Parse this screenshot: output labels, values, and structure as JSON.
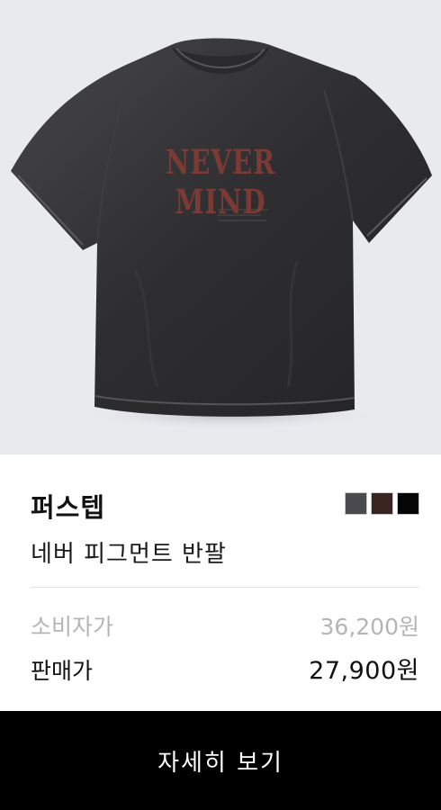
{
  "product": {
    "image_alt": "네버 피그먼트 반팔",
    "print_text": "NEVER MIND",
    "brand": "퍼스텝",
    "name": "네버 피그먼트 반팔",
    "color_options": [
      {
        "color": "#4b4b4f"
      },
      {
        "color": "#3a2422"
      },
      {
        "color": "#050505"
      }
    ]
  },
  "pricing": {
    "retail_label": "소비자가",
    "retail_price": "36,200원",
    "sale_label": "판매가",
    "sale_price": "27,900원"
  },
  "cta": {
    "label": "자세히 보기"
  }
}
